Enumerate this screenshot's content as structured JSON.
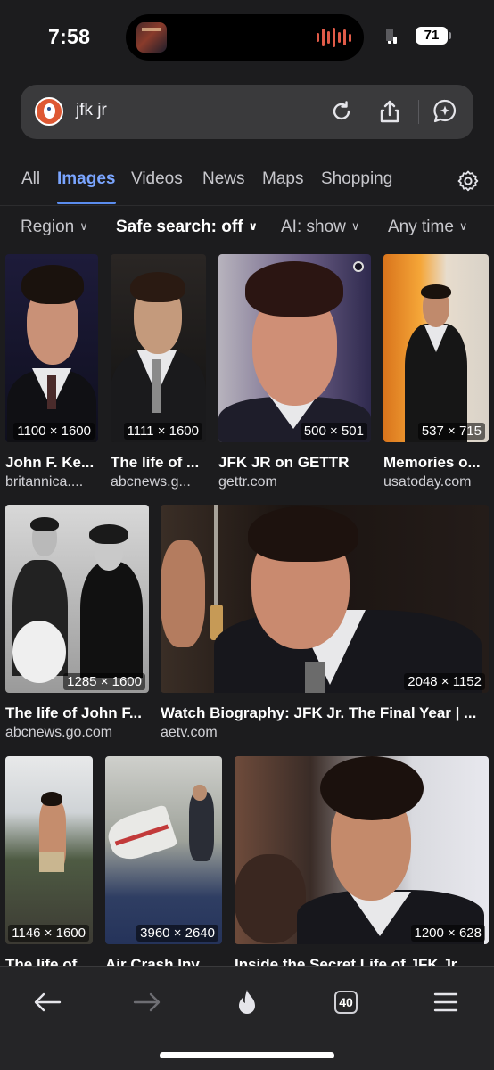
{
  "status_bar": {
    "time": "7:58",
    "battery": "71"
  },
  "address_bar": {
    "query": "jfk jr"
  },
  "tabs": [
    {
      "label": "All"
    },
    {
      "label": "Images"
    },
    {
      "label": "Videos"
    },
    {
      "label": "News"
    },
    {
      "label": "Maps"
    },
    {
      "label": "Shopping"
    }
  ],
  "active_tab": "Images",
  "filters": {
    "region": "Region",
    "safe_search": "Safe search: off",
    "ai": "AI: show",
    "time": "Any time"
  },
  "results": [
    {
      "title": "John F. Ke...",
      "source": "britannica....",
      "dimensions": "1100 × 1600"
    },
    {
      "title": "The life of ...",
      "source": "abcnews.g...",
      "dimensions": "1111 × 1600"
    },
    {
      "title": "JFK JR on GETTR",
      "source": "gettr.com",
      "dimensions": "500 × 501"
    },
    {
      "title": "Memories o...",
      "source": "usatoday.com",
      "dimensions": "537 × 715"
    },
    {
      "title": "The life of John F...",
      "source": "abcnews.go.com",
      "dimensions": "1285 × 1600"
    },
    {
      "title": "Watch Biography: JFK Jr. The Final Year | ...",
      "source": "aetv.com",
      "dimensions": "2048 × 1152"
    },
    {
      "title": "The life of ...",
      "source": "",
      "dimensions": "1146 × 1600"
    },
    {
      "title": "Air Crash Inv...",
      "source": "",
      "dimensions": "3960 × 2640"
    },
    {
      "title": "Inside the Secret Life of JFK Jr...",
      "source": "",
      "dimensions": "1200 × 628"
    }
  ],
  "toolbar": {
    "tab_count": "40"
  },
  "colors": {
    "accent": "#7aa5ff",
    "background": "#1c1c1e",
    "ddg_orange": "#de5833"
  }
}
